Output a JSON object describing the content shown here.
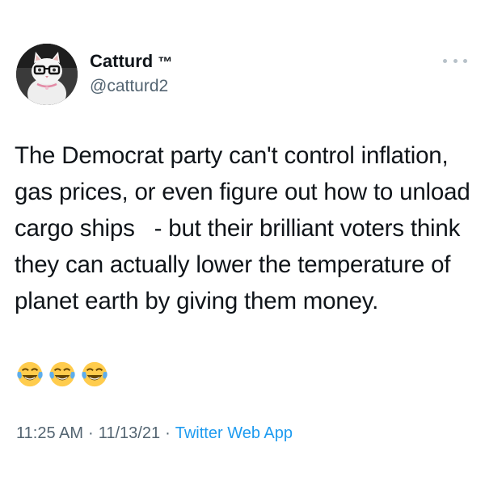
{
  "author": {
    "display_name": "Catturd",
    "badge": "™",
    "handle": "@catturd2"
  },
  "tweet": {
    "text": "The Democrat party can't control inflation, gas prices, or even figure out how to unload cargo ships   - but their brilliant voters think they can actually lower the temperature of planet earth by giving them money.",
    "emoji_count": 3,
    "emoji_name": "face-with-tears-of-joy"
  },
  "meta": {
    "time": "11:25 AM",
    "separator": "·",
    "date": "11/13/21",
    "source": "Twitter Web App"
  },
  "icons": {
    "more": "more-horizontal-icon",
    "avatar": "cat-with-glasses-avatar"
  },
  "colors": {
    "text_primary": "#0f1419",
    "text_secondary": "#536471",
    "link": "#1d9bf0",
    "more_dots": "#b7c1c9"
  }
}
